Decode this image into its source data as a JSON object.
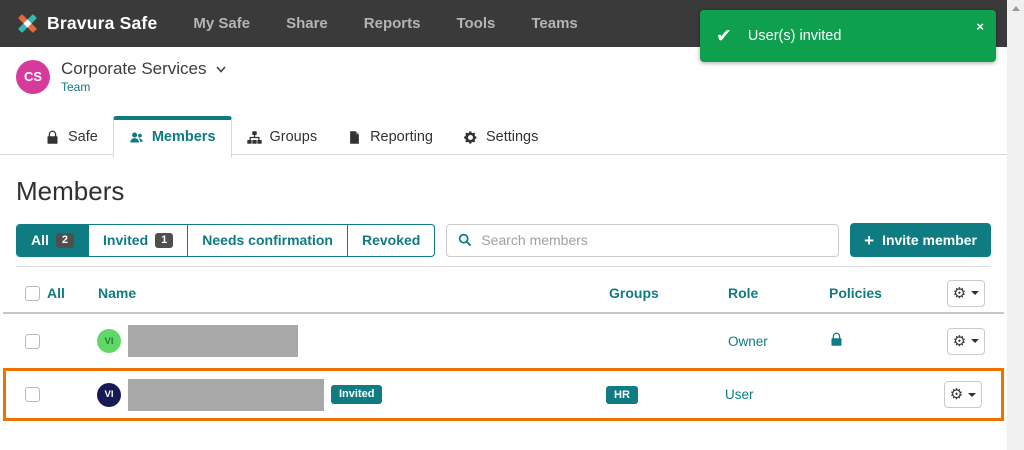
{
  "navbar": {
    "brand": "Bravura Safe",
    "items": [
      {
        "label": "My Safe"
      },
      {
        "label": "Share"
      },
      {
        "label": "Reports"
      },
      {
        "label": "Tools"
      },
      {
        "label": "Teams"
      }
    ]
  },
  "toast": {
    "message": "User(s) invited",
    "close_label": "×"
  },
  "team_header": {
    "initials": "CS",
    "name": "Corporate Services",
    "subtitle": "Team"
  },
  "tabs": [
    {
      "label": "Safe",
      "icon": "lock-icon",
      "active": false
    },
    {
      "label": "Members",
      "icon": "members-icon",
      "active": true
    },
    {
      "label": "Groups",
      "icon": "sitemap-icon",
      "active": false
    },
    {
      "label": "Reporting",
      "icon": "report-icon",
      "active": false
    },
    {
      "label": "Settings",
      "icon": "settings-icon",
      "active": false
    }
  ],
  "page": {
    "title": "Members"
  },
  "filters": {
    "all": {
      "label": "All",
      "count": "2",
      "active": true
    },
    "invited": {
      "label": "Invited",
      "count": "1",
      "active": false
    },
    "needs_confirmation": {
      "label": "Needs confirmation",
      "active": false
    },
    "revoked": {
      "label": "Revoked",
      "active": false
    }
  },
  "search": {
    "placeholder": "Search members"
  },
  "invite": {
    "label": "Invite member",
    "plus": "+"
  },
  "table": {
    "headers": {
      "select_all": "All",
      "name": "Name",
      "groups": "Groups",
      "role": "Role",
      "policies": "Policies"
    },
    "rows": [
      {
        "avatar_initials": "VI",
        "name_redacted": true,
        "status_badge": "",
        "group_badge": "",
        "role": "Owner",
        "policy_lock": true,
        "highlighted": false
      },
      {
        "avatar_initials": "VI",
        "name_redacted": true,
        "status_badge": "Invited",
        "group_badge": "HR",
        "role": "User",
        "policy_lock": false,
        "highlighted": true
      }
    ]
  },
  "colors": {
    "accent_teal": "#0e7c82",
    "toast_green": "#0fa04f",
    "highlight_orange": "#ef7200",
    "navbar_bg": "#3b3a3a",
    "avatar_team": "#d63a9c",
    "avatar_row1": "#5fd868",
    "avatar_row2": "#161c53",
    "logo_orange": "#e8683a",
    "logo_teal": "#35b8b2"
  }
}
